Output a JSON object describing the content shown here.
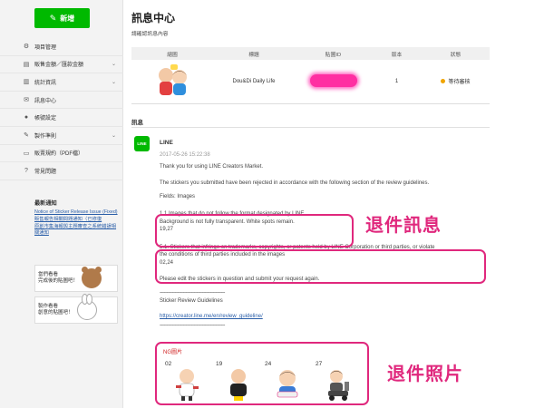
{
  "sidebar": {
    "new_button": "新增",
    "items": [
      {
        "label": "項目管理",
        "icon": "gear-icon",
        "glyph": "⚙",
        "chevron": false
      },
      {
        "label": "販售金額／匯款金額",
        "icon": "coin-icon",
        "glyph": "▤",
        "chevron": true
      },
      {
        "label": "統計資訊",
        "icon": "bar-chart-icon",
        "glyph": "▥",
        "chevron": true
      },
      {
        "label": "訊息中心",
        "icon": "envelope-icon",
        "glyph": "✉",
        "chevron": false
      },
      {
        "label": "帳號設定",
        "icon": "user-icon",
        "glyph": "👤",
        "chevron": false
      },
      {
        "label": "製作準則",
        "icon": "pencil-icon",
        "glyph": "✎",
        "chevron": true
      },
      {
        "label": "販賣規約（PDF檔）",
        "icon": "document-icon",
        "glyph": "▭",
        "chevron": false
      },
      {
        "label": "常見問題",
        "icon": "question-icon",
        "glyph": "?",
        "chevron": false
      }
    ],
    "news_title": "最新通知",
    "news_links": [
      "Notice of Sticker Release Issue (Fixed)",
      "販售報告相關問題通知（已修復",
      "原創市集海報與主題審查之系統錯誤相關通知"
    ],
    "promos": [
      {
        "text1": "當們看看",
        "text2": "完成後的貼圖吧！"
      },
      {
        "text1": "製作看看",
        "text2": "創意的貼圖吧！"
      }
    ]
  },
  "main": {
    "title": "訊息中心",
    "subtitle": "請確認訊息內容",
    "table": {
      "headers": [
        "縮圖",
        "標題",
        "貼圖ID",
        "版本",
        "狀態"
      ],
      "row": {
        "title": "Dou&Di Daily Life",
        "version": "1",
        "status": "等待審核"
      }
    },
    "messages_heading": "訊息",
    "message": {
      "sender": "LINE",
      "timestamp": "2017-05-26 15:22:38",
      "greeting": "Thank you for using LINE Creators Market.",
      "rejection": "The stickers you submitted have been rejected in accordance with the following section of the review guidelines.",
      "fields": "Fields: Images",
      "issue1_line1": "1.1 Images that do not follow the format designated by LINE",
      "issue1_line2": "Background is not fully transparent. White spots remain.",
      "issue1_nums": "19,27",
      "issue2_line1": "5.1. Stickers that infringe on trademarks, copyrights, or patents held by LINE Corporation or third parties, or violate",
      "issue2_line2": "the conditions of third parties included in the images",
      "issue2_nums": "02,24",
      "instruction": "Please edit the stickers in question and submit your request again.",
      "dashes1": "------------------------------------------------",
      "guideline_title": "Sticker Review Guidelines",
      "guideline_link": "https://creator.line.me/en/review_guideline/",
      "dashes2": "------------------------------------------------",
      "ng_label": "NG圖片",
      "ng_numbers": [
        "02",
        "19",
        "24",
        "27"
      ]
    },
    "annotations": {
      "reject_message": "退件訊息",
      "reject_photos": "退件照片"
    }
  },
  "colors": {
    "line_green": "#00b900",
    "annotation_pink": "#e0287d",
    "link_blue": "#2a5ea8",
    "status_pending": "#f0a400"
  }
}
